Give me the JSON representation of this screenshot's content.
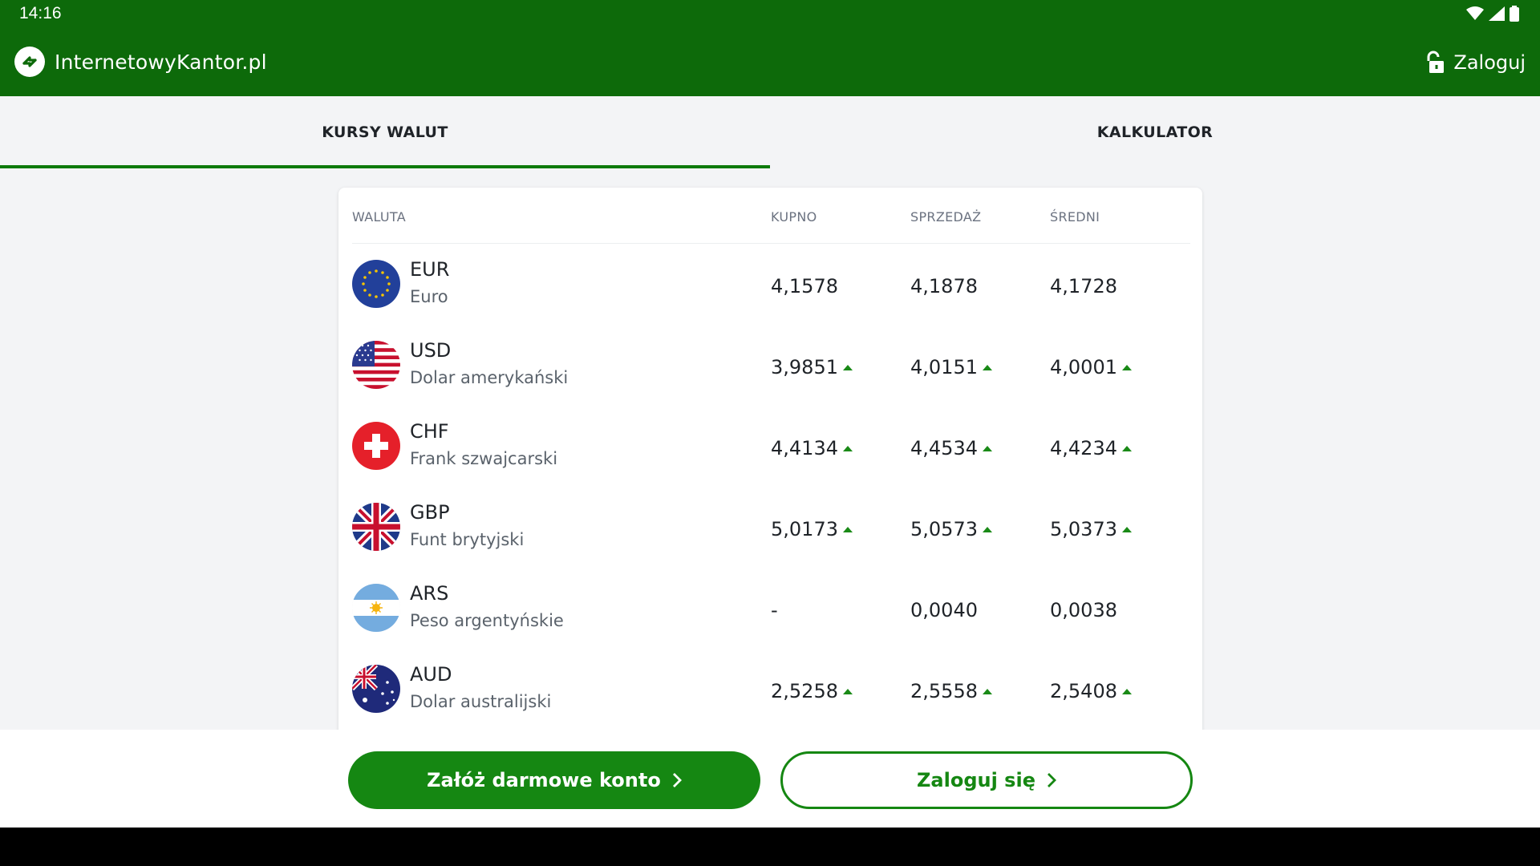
{
  "status": {
    "time": "14:16"
  },
  "header": {
    "brand": "InternetowyKantor.pl",
    "login_label": "Zaloguj"
  },
  "tabs": [
    {
      "label": "KURSY WALUT",
      "active": true
    },
    {
      "label": "KALKULATOR",
      "active": false
    }
  ],
  "table": {
    "columns": [
      "WALUTA",
      "KUPNO",
      "SPRZEDAŻ",
      "ŚREDNI"
    ],
    "rows": [
      {
        "code": "EUR",
        "name": "Euro",
        "flag": "eu-flag-icon",
        "buy": "4,1578",
        "sell": "4,1878",
        "mid": "4,1728",
        "buy_up": false,
        "sell_up": false,
        "mid_up": false
      },
      {
        "code": "USD",
        "name": "Dolar amerykański",
        "flag": "us-flag-icon",
        "buy": "3,9851",
        "sell": "4,0151",
        "mid": "4,0001",
        "buy_up": true,
        "sell_up": true,
        "mid_up": true
      },
      {
        "code": "CHF",
        "name": "Frank szwajcarski",
        "flag": "ch-flag-icon",
        "buy": "4,4134",
        "sell": "4,4534",
        "mid": "4,4234",
        "buy_up": true,
        "sell_up": true,
        "mid_up": true
      },
      {
        "code": "GBP",
        "name": "Funt brytyjski",
        "flag": "gb-flag-icon",
        "buy": "5,0173",
        "sell": "5,0573",
        "mid": "5,0373",
        "buy_up": true,
        "sell_up": true,
        "mid_up": true
      },
      {
        "code": "ARS",
        "name": "Peso argentyńskie",
        "flag": "ar-flag-icon",
        "buy": "-",
        "sell": "0,0040",
        "mid": "0,0038",
        "buy_up": false,
        "sell_up": false,
        "mid_up": false
      },
      {
        "code": "AUD",
        "name": "Dolar australijski",
        "flag": "au-flag-icon",
        "buy": "2,5258",
        "sell": "2,5558",
        "mid": "2,5408",
        "buy_up": true,
        "sell_up": true,
        "mid_up": true
      }
    ]
  },
  "actions": {
    "register_label": "Załóż darmowe konto",
    "login_label": "Zaloguj się"
  },
  "colors": {
    "brand": "#0d6a0a",
    "accent": "#158712",
    "trend_up": "#1a8a17"
  }
}
